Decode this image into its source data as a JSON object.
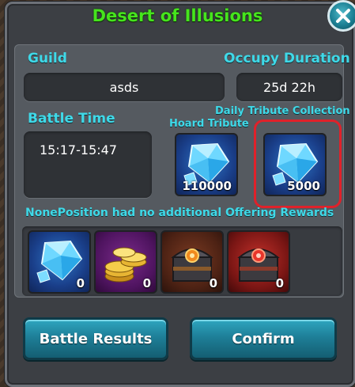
{
  "title": "Desert of Illusions",
  "guild": {
    "label": "Guild",
    "value": "asds"
  },
  "occupy": {
    "label": "Occupy Duration",
    "value": "25d 22h"
  },
  "battle_time": {
    "label": "Battle Time",
    "value": "15:17-15:47"
  },
  "daily_tribute_label": "Daily Tribute Collection",
  "hoard_tribute": {
    "label": "Hoard Tribute",
    "count": "110000",
    "icon": "blue-gem-icon"
  },
  "daily_tribute": {
    "count": "5000",
    "icon": "blue-gem-icon"
  },
  "rewards_notice": "NonePosition had no additional Offering Rewards",
  "rewards": [
    {
      "icon": "blue-gem-icon",
      "count": "0"
    },
    {
      "icon": "gold-coins-icon",
      "count": "0"
    },
    {
      "icon": "treasure-chest-icon",
      "count": "0"
    },
    {
      "icon": "red-treasure-chest-icon",
      "count": "0"
    }
  ],
  "buttons": {
    "battle_results": "Battle Results",
    "confirm": "Confirm"
  },
  "colors": {
    "title": "#46e41d",
    "label": "#3fd9e8",
    "highlight": "#e0212a",
    "button": "#1e7f98"
  }
}
